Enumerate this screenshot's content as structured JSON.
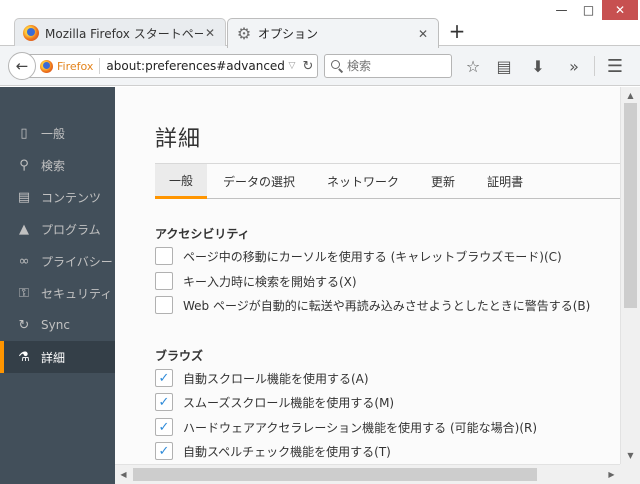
{
  "window": {
    "minimize_glyph": "—",
    "maximize_glyph": "□",
    "close_glyph": "✕"
  },
  "tabs": [
    {
      "label": "Mozilla Firefox スタートページ",
      "close": "✕",
      "icon": "firefox-icon"
    },
    {
      "label": "オプション",
      "close": "✕",
      "icon": "gear-icon"
    }
  ],
  "new_tab_label": "+",
  "navbar": {
    "identity_label": "Firefox",
    "url": "about:preferences#advanced",
    "search_placeholder": "検索",
    "icons": [
      "star-icon",
      "reading-list-icon",
      "download-icon",
      "overflow-chevron-icon",
      "menu-icon"
    ]
  },
  "sidebar": {
    "items": [
      {
        "label": "一般",
        "icon": "general-icon",
        "glyph": "▯"
      },
      {
        "label": "検索",
        "icon": "search-icon",
        "glyph": "⚲"
      },
      {
        "label": "コンテンツ",
        "icon": "content-icon",
        "glyph": "▤"
      },
      {
        "label": "プログラム",
        "icon": "applications-icon",
        "glyph": "▲"
      },
      {
        "label": "プライバシー",
        "icon": "privacy-mask-icon",
        "glyph": "∞"
      },
      {
        "label": "セキュリティ",
        "icon": "security-icon",
        "glyph": "⚿"
      },
      {
        "label": "Sync",
        "icon": "sync-icon",
        "glyph": "↻"
      },
      {
        "label": "詳細",
        "icon": "advanced-icon",
        "glyph": "⚗"
      }
    ],
    "selected": "詳細"
  },
  "main": {
    "title": "詳細",
    "tabs": [
      "一般",
      "データの選択",
      "ネットワーク",
      "更新",
      "証明書"
    ],
    "selected_tab": "一般",
    "sections": [
      {
        "title": "アクセシビリティ",
        "options": [
          {
            "label": "ページ中の移動にカーソルを使用する (キャレットブラウズモード)(C)",
            "checked": false
          },
          {
            "label": "キー入力時に検索を開始する(X)",
            "checked": false
          },
          {
            "label": "Web ページが自動的に転送や再読み込みさせようとしたときに警告する(B)",
            "checked": false
          }
        ]
      },
      {
        "title": "ブラウズ",
        "options": [
          {
            "label": "自動スクロール機能を使用する(A)",
            "checked": true
          },
          {
            "label": "スムーズスクロール機能を使用する(M)",
            "checked": true
          },
          {
            "label": "ハードウェアアクセラレーション機能を使用する (可能な場合)(R)",
            "checked": true
          },
          {
            "label": "自動スペルチェック機能を使用する(T)",
            "checked": true
          }
        ]
      }
    ]
  },
  "colors": {
    "accent": "#ff9500",
    "sidebar_bg": "#424f5a",
    "checkmark": "#2f8bd9"
  }
}
